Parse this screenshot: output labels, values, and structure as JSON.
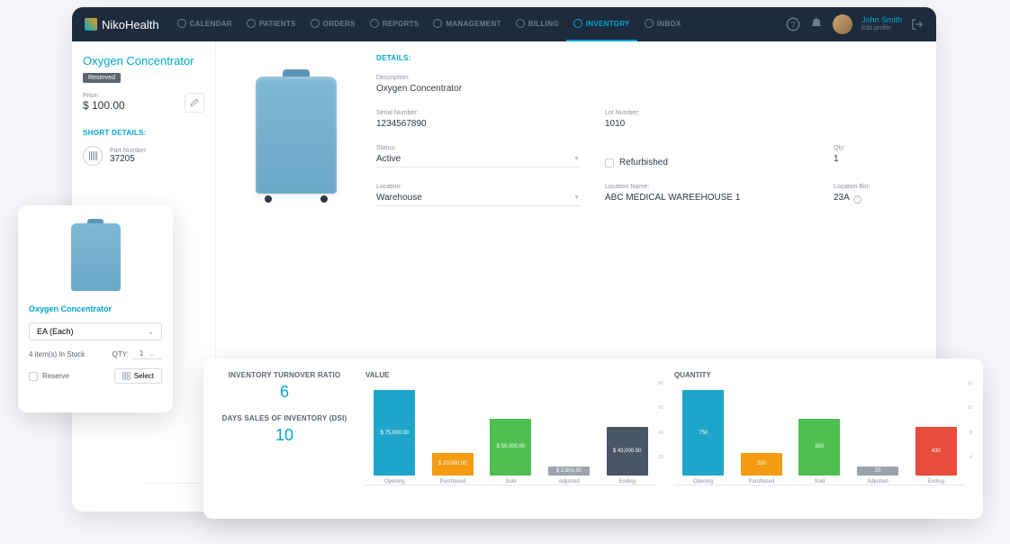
{
  "app": {
    "name": "NikoHealth"
  },
  "nav": [
    {
      "label": "CALENDAR"
    },
    {
      "label": "PATIENTS"
    },
    {
      "label": "ORDERS"
    },
    {
      "label": "REPORTS"
    },
    {
      "label": "MANAGEMENT"
    },
    {
      "label": "BILLING"
    },
    {
      "label": "INVENTORY",
      "active": true
    },
    {
      "label": "INBOX"
    }
  ],
  "user": {
    "name": "John Smith",
    "sub": "Edit profile"
  },
  "product": {
    "title": "Oxygen Concentrator",
    "badge": "Reserved",
    "price_label": "Price:",
    "price": "$ 100.00",
    "short_details_header": "SHORT DETAILS:",
    "part_label": "Part Number:",
    "part_number": "37205"
  },
  "details": {
    "header": "DETAILS:",
    "description_label": "Description:",
    "description": "Oxygen Concentrator",
    "serial_label": "Serial Number:",
    "serial": "1234567890",
    "lot_label": "Lot Number:",
    "lot": "1010",
    "status_label": "Status:",
    "status": "Active",
    "refurbished_label": "Refurbished",
    "qty_label": "Qty:",
    "qty": "1",
    "location_label": "Location:",
    "location": "Warehouse",
    "location_name_label": "Location Name:",
    "location_name": "ABC MEDICAL WAREEHOUSE 1",
    "bin_label": "Location Bin:",
    "bin": "23A"
  },
  "small_card": {
    "title": "Oxygen Concentrator",
    "unit_select": "EA (Each)",
    "stock": "4 item(s) In Stock",
    "qty_label": "QTY:",
    "qty": "1",
    "reserve": "Reserve",
    "select_btn": "Select"
  },
  "metrics": {
    "turnover_label": "INVENTORY TURNOVER RATIO",
    "turnover": "6",
    "dsi_label": "DAYS SALES OF INVENTORY (DSI)",
    "dsi": "10",
    "value_header": "VALUE",
    "quantity_header": "QUANTITY"
  },
  "chart_data": [
    {
      "type": "bar",
      "title": "VALUE",
      "categories": [
        "Opening",
        "Purchased",
        "Sold",
        "Adjusted",
        "Ending"
      ],
      "values": [
        75000,
        20000,
        50000,
        2800,
        43000
      ],
      "labels": [
        "$ 75,000.00",
        "$ 20,000.00",
        "$ 50,000.00",
        "$ 2,800.00",
        "$ 43,000.00"
      ],
      "colors": [
        "#1ea5c9",
        "#f39c12",
        "#4fc04f",
        "#9aa3ae",
        "#4a5566"
      ],
      "ylim": [
        0,
        80
      ],
      "yticks": [
        20,
        40,
        60,
        80
      ]
    },
    {
      "type": "bar",
      "title": "QUANTITY",
      "categories": [
        "Opening",
        "Purchased",
        "Sold",
        "Adjusted",
        "Ending"
      ],
      "values": [
        750,
        200,
        500,
        20,
        430
      ],
      "labels": [
        "750",
        "200",
        "500",
        "20",
        "430"
      ],
      "colors": [
        "#1ea5c9",
        "#f39c12",
        "#4fc04f",
        "#9aa3ae",
        "#e74c3c"
      ],
      "ylim": [
        0,
        16
      ],
      "yticks": [
        4,
        8,
        12,
        16
      ]
    }
  ]
}
